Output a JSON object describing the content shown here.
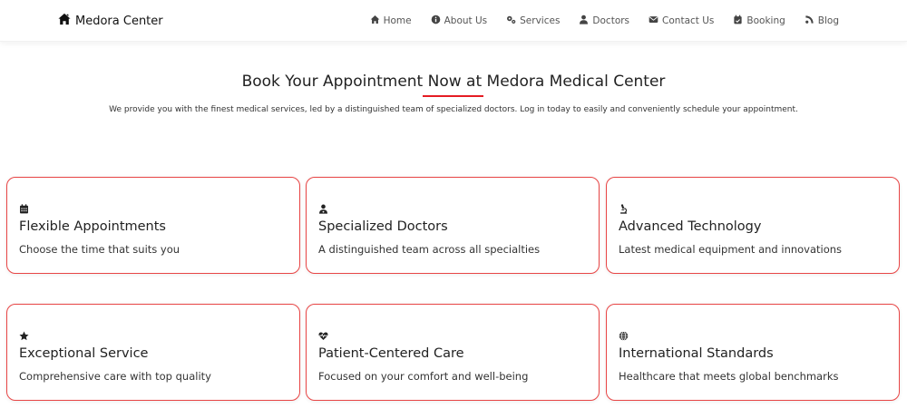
{
  "brand": {
    "name": "Medora Center",
    "icon": "house-icon"
  },
  "nav": {
    "items": [
      {
        "label": "Home",
        "icon": "home-icon"
      },
      {
        "label": "About Us",
        "icon": "info-circle-icon"
      },
      {
        "label": "Services",
        "icon": "gears-icon"
      },
      {
        "label": "Doctors",
        "icon": "doctor-icon"
      },
      {
        "label": "Contact Us",
        "icon": "envelope-icon"
      },
      {
        "label": "Booking",
        "icon": "calendar-check-icon"
      },
      {
        "label": "Blog",
        "icon": "blog-icon"
      }
    ]
  },
  "hero": {
    "title": "Book Your Appointment Now at Medora Medical Center",
    "subtitle": "We provide you with the finest medical services, led by a distinguished team of specialized doctors. Log in today to easily and conveniently schedule your appointment.",
    "accent_color": "#e51c23"
  },
  "features": [
    {
      "icon": "calendar-icon",
      "title": "Flexible Appointments",
      "description": "Choose the time that suits you"
    },
    {
      "icon": "doctor-icon",
      "title": "Specialized Doctors",
      "description": "A distinguished team across all specialties"
    },
    {
      "icon": "microscope-icon",
      "title": "Advanced Technology",
      "description": "Latest medical equipment and innovations"
    },
    {
      "icon": "star-icon",
      "title": "Exceptional Service",
      "description": "Comprehensive care with top quality"
    },
    {
      "icon": "heart-pulse-icon",
      "title": "Patient-Centered Care",
      "description": "Focused on your comfort and well-being"
    },
    {
      "icon": "globe-icon",
      "title": "International Standards",
      "description": "Healthcare that meets global benchmarks"
    }
  ],
  "colors": {
    "card_border": "#e84545",
    "text": "#222222"
  }
}
